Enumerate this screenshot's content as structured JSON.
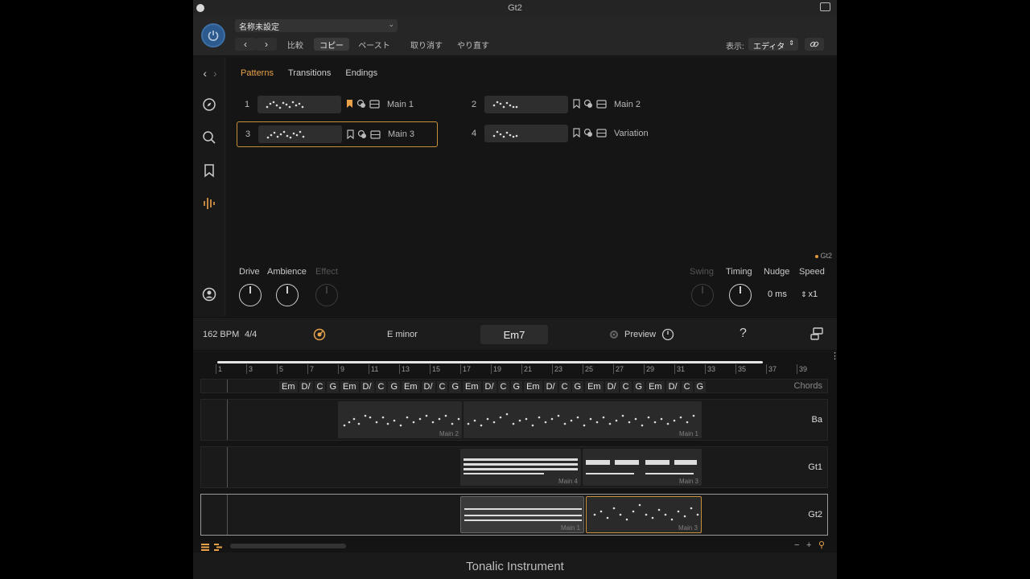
{
  "window": {
    "title": "Gt2"
  },
  "header": {
    "preset": "名称未設定",
    "compare": "比較",
    "copy": "コピー",
    "paste": "ペースト",
    "undo": "取り消す",
    "redo": "やり直す",
    "view_label": "表示:",
    "view_value": "エディタ"
  },
  "tabs": [
    "Patterns",
    "Transitions",
    "Endings"
  ],
  "patterns": [
    {
      "num": "1",
      "name": "Main 1"
    },
    {
      "num": "2",
      "name": "Main 2"
    },
    {
      "num": "3",
      "name": "Main 3"
    },
    {
      "num": "4",
      "name": "Variation"
    }
  ],
  "instrument_tag": "Gt2",
  "knobs": {
    "drive": "Drive",
    "ambience": "Ambience",
    "effect": "Effect",
    "swing": "Swing",
    "timing": "Timing",
    "nudge": "Nudge",
    "speed": "Speed",
    "nudge_value": "0 ms",
    "speed_value": "x1"
  },
  "transport": {
    "tempo": "162 BPM",
    "meter": "4/4",
    "key": "E minor",
    "current_chord": "Em7",
    "preview": "Preview",
    "help": "?"
  },
  "ruler": [
    "1",
    "3",
    "5",
    "7",
    "9",
    "11",
    "13",
    "15",
    "17",
    "19",
    "21",
    "23",
    "25",
    "27",
    "29",
    "31",
    "33",
    "35",
    "37",
    "39"
  ],
  "chords_track": {
    "name": "Chords",
    "chords": [
      "Em",
      "D/",
      "C",
      "G",
      "Em",
      "D/",
      "C",
      "G",
      "Em",
      "D/",
      "C",
      "G",
      "Em",
      "D/",
      "C",
      "G",
      "Em",
      "D/",
      "C",
      "G",
      "Em",
      "D/",
      "C",
      "G",
      "Em",
      "D/",
      "C",
      "G"
    ]
  },
  "tracks": [
    {
      "name": "Ba",
      "regions": [
        "Main 2",
        "Main 1"
      ]
    },
    {
      "name": "Gt1",
      "regions": [
        "Main 4",
        "Main 3"
      ]
    },
    {
      "name": "Gt2",
      "regions": [
        "Main 1",
        "Main 3"
      ]
    }
  ],
  "footer": "Tonalic Instrument",
  "colors": {
    "accent": "#e9a24a",
    "power": "#2c5a8f",
    "selection": "#c7913c"
  }
}
